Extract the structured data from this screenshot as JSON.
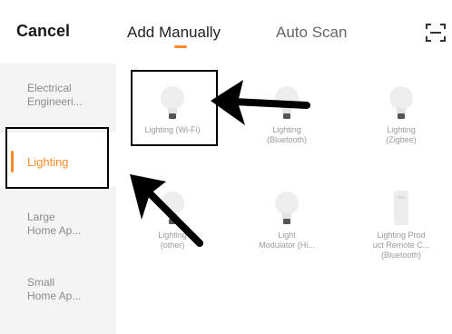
{
  "header": {
    "cancel_label": "Cancel",
    "tabs": [
      {
        "label": "Add Manually",
        "selected": true
      },
      {
        "label": "Auto Scan",
        "selected": false
      }
    ],
    "scan_icon": "scan-icon"
  },
  "sidebar": {
    "items": [
      {
        "line1": "Electrical",
        "line2": "Engineeri..."
      },
      {
        "line1": "Lighting",
        "line2": ""
      },
      {
        "line1": "Large",
        "line2": "Home Ap..."
      },
      {
        "line1": "Small",
        "line2": "Home Ap..."
      }
    ],
    "selected_index": 1
  },
  "devices": [
    {
      "lines": [
        "Lighting (Wi-Fi)"
      ],
      "icon": "bulb-icon"
    },
    {
      "lines": [
        "Lighting",
        "(Bluetooth)"
      ],
      "icon": "bulb-icon"
    },
    {
      "lines": [
        "Lighting",
        "(Zigbee)"
      ],
      "icon": "bulb-icon"
    },
    {
      "lines": [
        "Lighting",
        "(other)"
      ],
      "icon": "bulb-icon"
    },
    {
      "lines": [
        "Light",
        "Modulator (Hi..."
      ],
      "icon": "bulb-icon"
    },
    {
      "lines": [
        "Lighting Prod",
        "uct Remote C...",
        "(Bluetooth)"
      ],
      "icon": "remote-icon"
    }
  ],
  "colors": {
    "accent": "#ff8a2a",
    "sidebar_bg": "#f4f4f4",
    "annotation": "#000000"
  }
}
